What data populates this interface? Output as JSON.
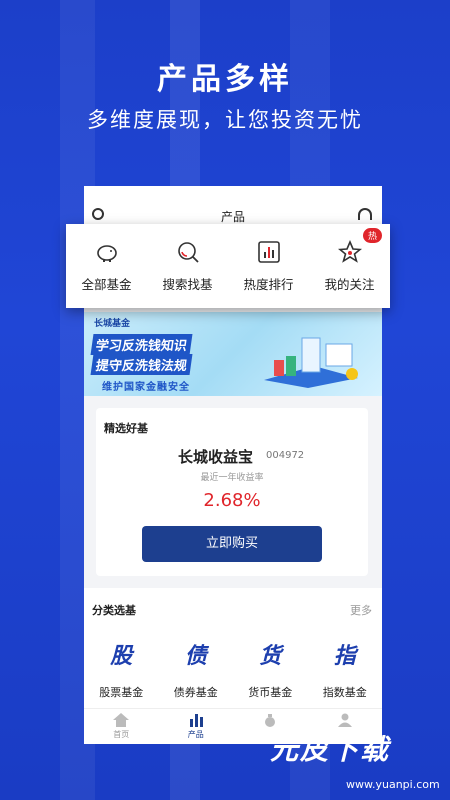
{
  "hero": {
    "title": "产品多样",
    "subtitle": "多维度展现，让您投资无忧"
  },
  "app": {
    "page_title": "产品",
    "quick_menu": [
      {
        "label": "全部基金",
        "icon": "piggy-bank-icon"
      },
      {
        "label": "搜索找基",
        "icon": "search-icon"
      },
      {
        "label": "热度排行",
        "icon": "bar-chart-icon"
      },
      {
        "label": "我的关注",
        "icon": "star-icon"
      }
    ],
    "hot_badge": "热",
    "banner": {
      "brand": "长城基金",
      "line1": "学习反洗钱知识",
      "line2": "提守反洗钱法规",
      "line3": "维护国家金融安全"
    },
    "featured": {
      "section_title": "精选好基",
      "fund_name": "长城收益宝",
      "fund_code": "004972",
      "rate_label": "最近一年收益率",
      "rate_value": "2.68%",
      "buy_label": "立即购买"
    },
    "categories": {
      "title": "分类选基",
      "more": "更多",
      "items": [
        {
          "glyph": "股",
          "label": "股票基金"
        },
        {
          "glyph": "债",
          "label": "债券基金"
        },
        {
          "glyph": "货",
          "label": "货币基金"
        },
        {
          "glyph": "指",
          "label": "指数基金"
        }
      ]
    },
    "tabs": [
      {
        "label": "首页",
        "icon": "home-icon"
      },
      {
        "label": "产品",
        "icon": "product-chart-icon"
      },
      {
        "label": "",
        "icon": "money-bag-icon"
      },
      {
        "label": "",
        "icon": "user-icon"
      }
    ]
  },
  "watermark": {
    "logo_text": "元皮下载",
    "url": "www.yuanpi.com"
  },
  "colors": {
    "background": "#1c3fc9",
    "accent": "#1d3f8f",
    "rate": "#e0252b",
    "category_glyph": "#1d3fae"
  }
}
